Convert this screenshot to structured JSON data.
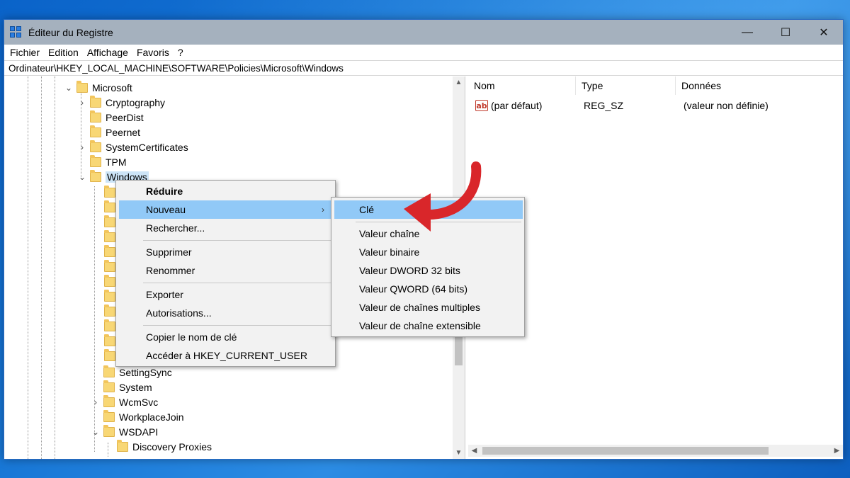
{
  "window": {
    "title": "Éditeur du Registre",
    "minimize": "—",
    "maximize": "☐",
    "close": "✕"
  },
  "menubar": {
    "items": [
      "Fichier",
      "Edition",
      "Affichage",
      "Favoris",
      "?"
    ]
  },
  "address": "Ordinateur\\HKEY_LOCAL_MACHINE\\SOFTWARE\\Policies\\Microsoft\\Windows",
  "tree": {
    "rows": [
      {
        "label": "Microsoft",
        "expander": "⌄"
      },
      {
        "label": "Cryptography",
        "expander": "›"
      },
      {
        "label": "PeerDist",
        "expander": ""
      },
      {
        "label": "Peernet",
        "expander": ""
      },
      {
        "label": "SystemCertificates",
        "expander": "›"
      },
      {
        "label": "TPM",
        "expander": ""
      },
      {
        "label": "Windows",
        "expander": "⌄"
      },
      {
        "label": "SettingSync",
        "expander": ""
      },
      {
        "label": "System",
        "expander": ""
      },
      {
        "label": "WcmSvc",
        "expander": "›"
      },
      {
        "label": "WorkplaceJoin",
        "expander": ""
      },
      {
        "label": "WSDAPI",
        "expander": "⌄"
      },
      {
        "label": "Discovery Proxies",
        "expander": ""
      }
    ]
  },
  "values_pane": {
    "headers": {
      "name": "Nom",
      "type": "Type",
      "data": "Données"
    },
    "rows": [
      {
        "icon": "ab",
        "name": "(par défaut)",
        "type": "REG_SZ",
        "data": "(valeur non définie)"
      }
    ]
  },
  "context_menu": {
    "items": [
      "Réduire",
      "Nouveau",
      "Rechercher...",
      "Supprimer",
      "Renommer",
      "Exporter",
      "Autorisations...",
      "Copier le nom de clé",
      "Accéder à HKEY_CURRENT_USER"
    ],
    "submenu_arrow": "›"
  },
  "submenu": {
    "items": [
      "Clé",
      "Valeur chaîne",
      "Valeur binaire",
      "Valeur DWORD 32 bits",
      "Valeur QWORD (64 bits)",
      "Valeur de chaînes multiples",
      "Valeur de chaîne extensible"
    ]
  },
  "colors": {
    "accent_arrow": "#d9262a",
    "highlight": "#91c9f7",
    "titlebar": "#a5b1be"
  }
}
